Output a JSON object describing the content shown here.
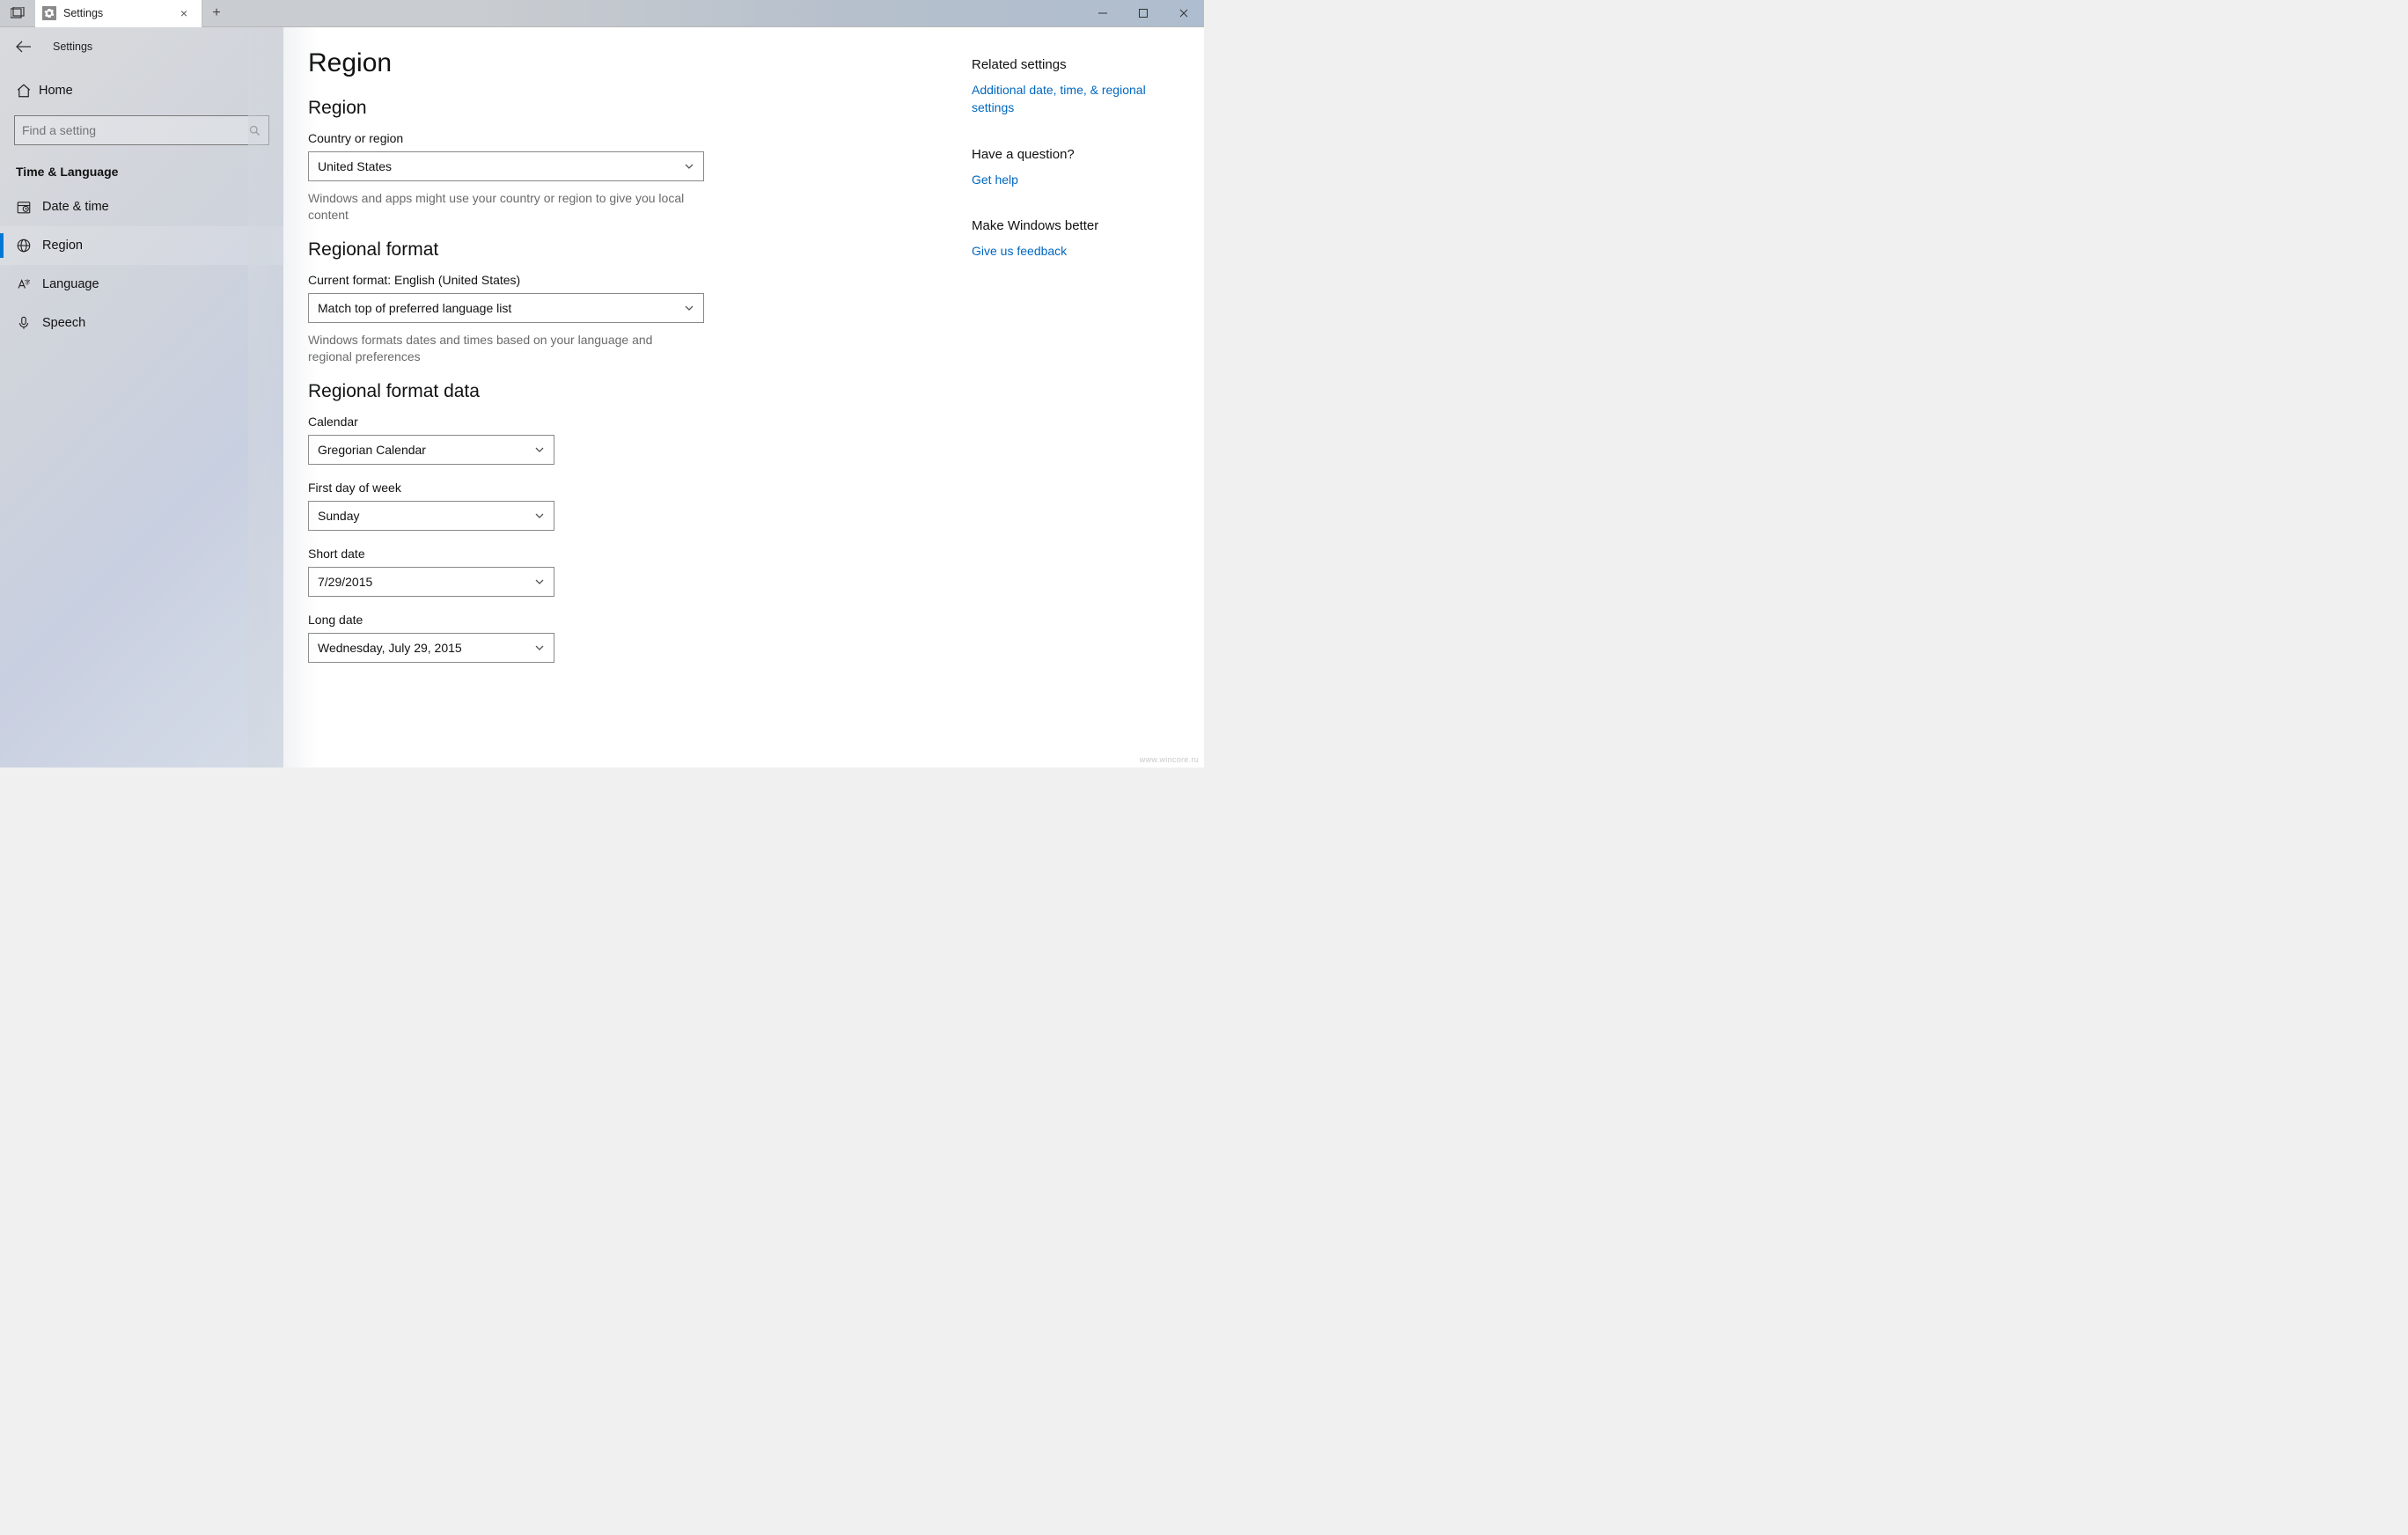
{
  "titlebar": {
    "tab_title": "Settings",
    "close_glyph": "×",
    "plus_glyph": "+"
  },
  "sidebar": {
    "app_name": "Settings",
    "home_label": "Home",
    "search_placeholder": "Find a setting",
    "section_title": "Time & Language",
    "items": [
      {
        "label": "Date & time"
      },
      {
        "label": "Region"
      },
      {
        "label": "Language"
      },
      {
        "label": "Speech"
      }
    ]
  },
  "main": {
    "page_title": "Region",
    "region_heading": "Region",
    "country_label": "Country or region",
    "country_value": "United States",
    "country_desc": "Windows and apps might use your country or region to give you local content",
    "regional_format_heading": "Regional format",
    "current_format_label": "Current format: English (United States)",
    "current_format_value": "Match top of preferred language list",
    "regional_format_desc": "Windows formats dates and times based on your language and regional preferences",
    "regional_format_data_heading": "Regional format data",
    "calendar_label": "Calendar",
    "calendar_value": "Gregorian Calendar",
    "firstday_label": "First day of week",
    "firstday_value": "Sunday",
    "shortdate_label": "Short date",
    "shortdate_value": "7/29/2015",
    "longdate_label": "Long date",
    "longdate_value": "Wednesday, July 29, 2015"
  },
  "right": {
    "related_heading": "Related settings",
    "related_link": "Additional date, time, & regional settings",
    "question_heading": "Have a question?",
    "get_help": "Get help",
    "better_heading": "Make Windows better",
    "feedback": "Give us feedback"
  },
  "watermark": "www.wincore.ru"
}
